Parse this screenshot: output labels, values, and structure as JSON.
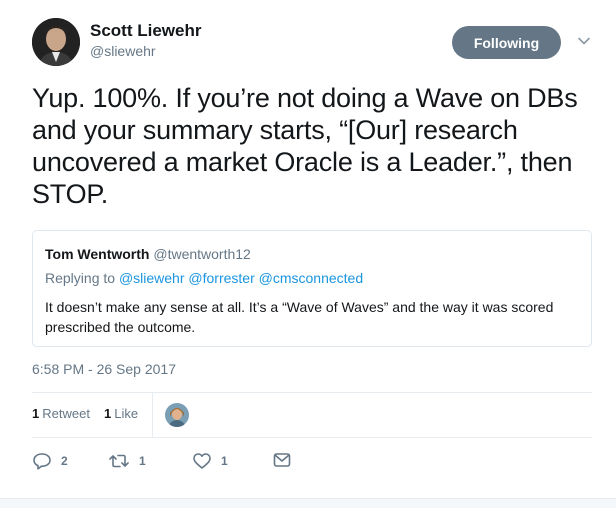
{
  "author": {
    "name": "Scott Liewehr",
    "handle": "@sliewehr"
  },
  "follow_button_label": "Following",
  "tweet_text": "Yup. 100%. If you’re not doing a Wave on DBs and your summary starts, “[Our] research uncovered a market Oracle is a Leader.”, then STOP.",
  "quoted": {
    "name": "Tom Wentworth",
    "handle": "@twentworth12",
    "replying_prefix": "Replying to",
    "replying_to": [
      "@sliewehr",
      "@forrester",
      "@cmsconnected"
    ],
    "text": "It doesn’t make any sense at all. It’s a “Wave of Waves” and the way it was scored prescribed the outcome."
  },
  "timestamp": "6:58 PM - 26 Sep 2017",
  "stats": {
    "retweets_count": "1",
    "retweets_label": "Retweet",
    "likes_count": "1",
    "likes_label": "Like"
  },
  "actions": {
    "reply_count": "2",
    "retweet_count": "1",
    "like_count": "1"
  },
  "colors": {
    "link": "#1b95e0",
    "muted": "#657786",
    "follow_button_bg": "#657786"
  },
  "icons": [
    "reply-icon",
    "retweet-icon",
    "heart-icon",
    "message-icon",
    "chevron-down-icon"
  ]
}
